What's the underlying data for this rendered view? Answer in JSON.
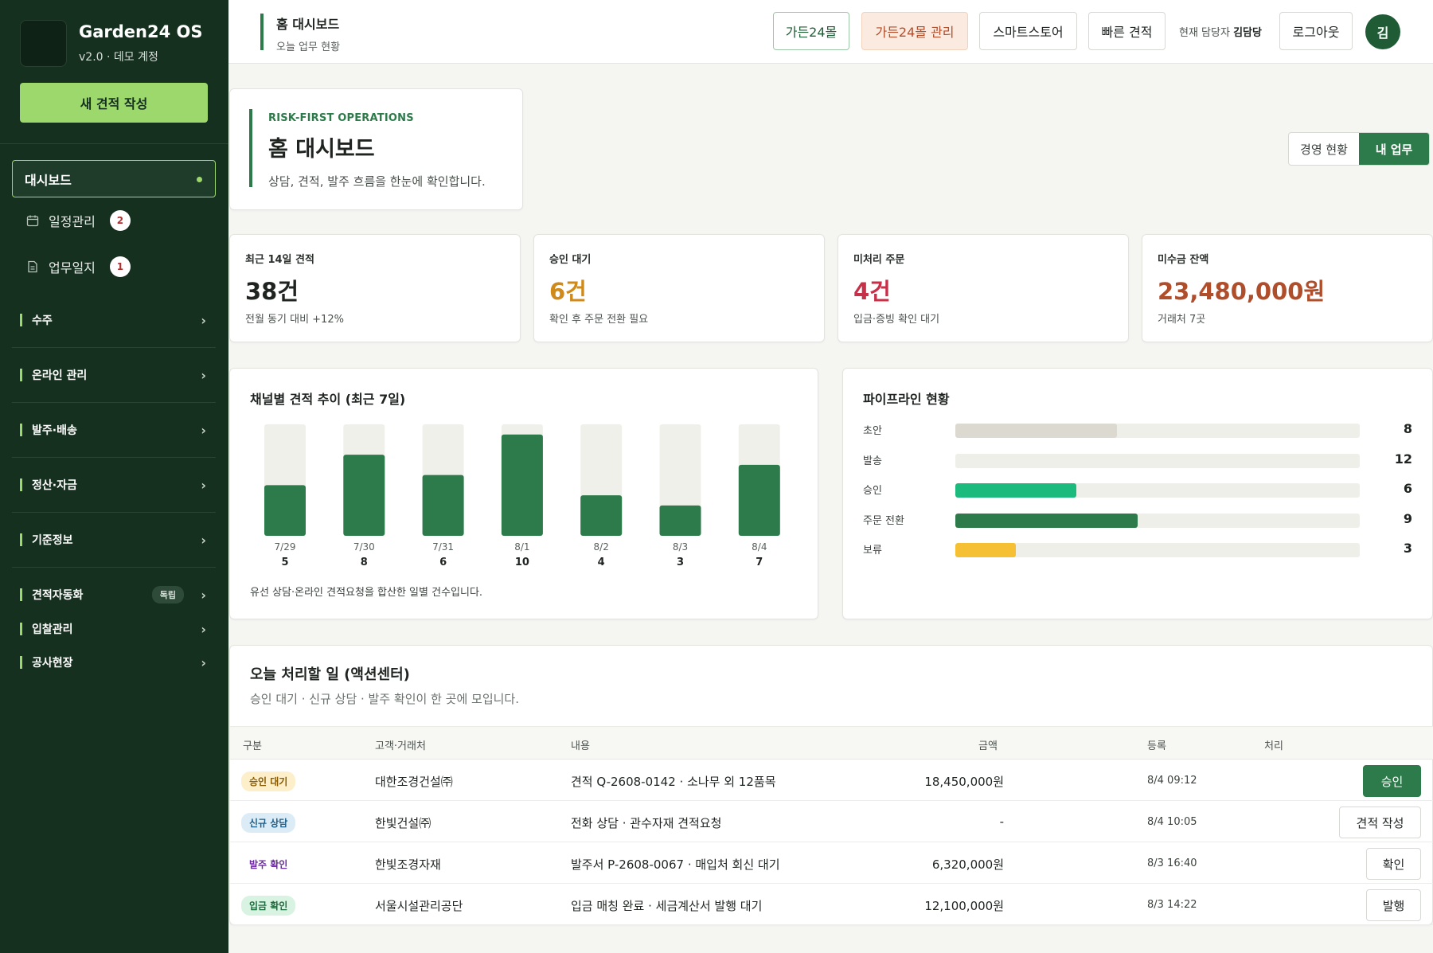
{
  "sidebar": {
    "brand_name": "Garden24 OS",
    "brand_version": "v2.0 · 데모 계정",
    "new_quote_label": "새 견적 작성",
    "active_item": "대시보드",
    "sub_items": [
      {
        "label": "일정관리",
        "badge": "2",
        "icon": "calendar-icon"
      },
      {
        "label": "업무일지",
        "badge": "1",
        "icon": "document-icon"
      }
    ],
    "groups": [
      {
        "label": "수주"
      },
      {
        "label": "온라인 관리"
      },
      {
        "label": "발주·배송"
      },
      {
        "label": "정산·자금"
      },
      {
        "label": "기준정보"
      },
      {
        "label": "견적자동화",
        "tag": "독립"
      },
      {
        "label": "입찰관리"
      },
      {
        "label": "공사현장"
      }
    ]
  },
  "header": {
    "title": "홈 대시보드",
    "subtitle": "오늘 업무 현황",
    "buttons": {
      "mall": "가든24몰",
      "admin": "가든24몰 관리",
      "store": "스마트스토어",
      "quick": "빠른 견적",
      "logout": "로그아웃"
    },
    "manager_label": "현재 담당자",
    "manager_name": "김담당",
    "avatar_initial": "김"
  },
  "hero": {
    "eyebrow": "RISK-FIRST OPERATIONS",
    "title": "홈 대시보드",
    "description": "상담, 견적, 발주 흐름을 한눈에 확인합니다."
  },
  "view_toggle": {
    "options": [
      "경영 현황",
      "내 업무"
    ],
    "selected": "내 업무"
  },
  "kpis": [
    {
      "label": "최근 14일 견적",
      "value": "38건",
      "sub": "전월 동기 대비 +12%",
      "color": "#1f2421"
    },
    {
      "label": "승인 대기",
      "value": "6건",
      "sub": "확인 후 주문 전환 필요",
      "color": "#d08a1a"
    },
    {
      "label": "미처리 주문",
      "value": "4건",
      "sub": "입금·증빙 확인 대기",
      "color": "#c8304a"
    },
    {
      "label": "미수금 잔액",
      "value": "23,480,000원",
      "sub": "거래처 7곳",
      "color": "#b04d2a"
    }
  ],
  "chart_data": {
    "type": "bar",
    "title": "채널별 견적 추이 (최근 7일)",
    "categories": [
      "7/29",
      "7/30",
      "7/31",
      "8/1",
      "8/2",
      "8/3",
      "8/4"
    ],
    "values": [
      5,
      8,
      6,
      10,
      4,
      3,
      7
    ],
    "ylim": [
      0,
      11
    ],
    "bar_color": "#2d7a4a",
    "track_color": "#f0f0eb",
    "note": "유선 상담·온라인 견적요청을 합산한 일별 건수입니다."
  },
  "pipeline": {
    "title": "파이프라인 현황",
    "max": 20,
    "stages": [
      {
        "label": "초안",
        "value": 8,
        "color": "#dcdad0"
      },
      {
        "label": "발송",
        "value": 12,
        "color": "#efefea"
      },
      {
        "label": "승인",
        "value": 6,
        "color": "#1dba7e"
      },
      {
        "label": "주문 전환",
        "value": 9,
        "color": "#2d7a4a"
      },
      {
        "label": "보류",
        "value": 3,
        "color": "#f5c034"
      }
    ]
  },
  "actions": {
    "title": "오늘 처리할 일 (액션센터)",
    "subtitle": "승인 대기 · 신규 상담 · 발주 확인이 한 곳에 모입니다.",
    "columns": [
      "구분",
      "고객·거래처",
      "내용",
      "금액",
      "등록",
      "처리"
    ],
    "rows": [
      {
        "type": "승인 대기",
        "type_bg": "#fcefc9",
        "type_fg": "#8a5a00",
        "customer": "대한조경건설㈜",
        "content": "견적 Q-2608-0142 · 소나무 외 12품목",
        "amount": "18,450,000원",
        "registered": "8/4 09:12",
        "action": "승인",
        "primary": true
      },
      {
        "type": "신규 상담",
        "type_bg": "#dcecf7",
        "type_fg": "#1f5f8a",
        "customer": "한빛건설㈜",
        "content": "전화 상담 · 관수자재 견적요청",
        "amount": "-",
        "registered": "8/4 10:05",
        "action": "견적 작성",
        "primary": false
      },
      {
        "type": "발주 확인",
        "type_bg": "#ffffff",
        "type_fg": "#6a2aa0",
        "customer": "한빛조경자재",
        "content": "발주서 P-2608-0067 · 매입처 회신 대기",
        "amount": "6,320,000원",
        "registered": "8/3 16:40",
        "action": "확인",
        "primary": false
      },
      {
        "type": "입금 확인",
        "type_bg": "#d9f3e3",
        "type_fg": "#1e6b3e",
        "customer": "서울시설관리공단",
        "content": "입금 매칭 완료 · 세금계산서 발행 대기",
        "amount": "12,100,000원",
        "registered": "8/3 14:22",
        "action": "발행",
        "primary": false
      }
    ]
  }
}
